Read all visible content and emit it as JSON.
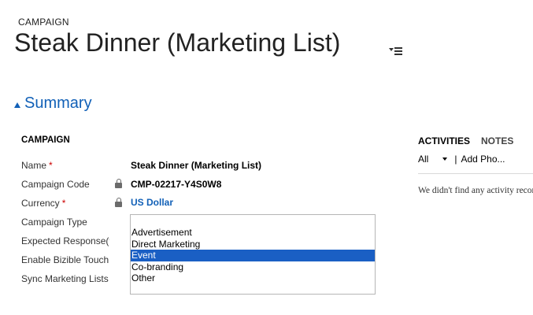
{
  "header": {
    "entity_type": "CAMPAIGN",
    "record_title": "Steak Dinner (Marketing List)"
  },
  "section": {
    "title": "Summary"
  },
  "form": {
    "group_title": "CAMPAIGN",
    "fields": [
      {
        "label": "Name",
        "required": "*",
        "value": "Steak Dinner (Marketing List)"
      },
      {
        "label": "Campaign Code",
        "value": "CMP-02217-Y4S0W8",
        "locked": true
      },
      {
        "label": "Currency",
        "required": "*",
        "value": "US Dollar",
        "locked": true
      },
      {
        "label": "Campaign Type"
      },
      {
        "label": "Expected Response(%)"
      },
      {
        "label": "Enable Bizible Touchpoints"
      },
      {
        "label": "Sync Marketing Lists"
      }
    ],
    "campaign_type_options": [
      "Advertisement",
      "Direct Marketing",
      "Event",
      "Co-branding",
      "Other"
    ],
    "campaign_type_selected": "Event"
  },
  "activities": {
    "tabs": [
      "ACTIVITIES",
      "NOTES"
    ],
    "filter": "All",
    "separator": "|",
    "add_label": "Add Pho...",
    "empty_message": "We didn't find any activity records."
  },
  "colors": {
    "accent": "#1160b7",
    "selected_option": "#1a5fc4",
    "required": "#cc0000"
  }
}
